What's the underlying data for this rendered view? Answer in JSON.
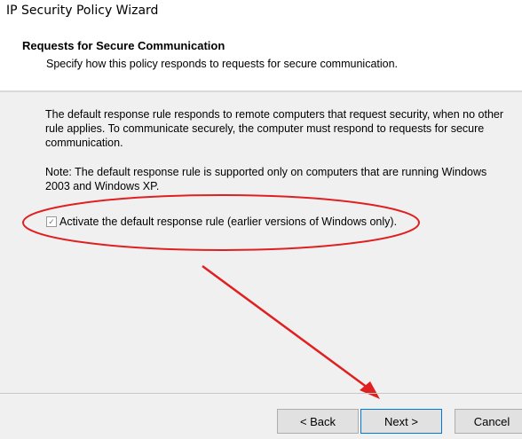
{
  "window": {
    "title": "IP Security Policy Wizard"
  },
  "header": {
    "title": "Requests for Secure Communication",
    "subtitle": "Specify how this policy responds to requests for secure communication."
  },
  "body": {
    "paragraph1": "The default response rule responds to remote computers that request security, when no other rule applies. To communicate securely, the computer must respond to requests for secure communication.",
    "paragraph2": "Note: The default response rule is supported only on computers that are running Windows 2003 and Windows XP.",
    "checkbox": {
      "label": "Activate the default response rule (earlier versions of Windows only).",
      "checked": true,
      "mark": "☑"
    }
  },
  "buttons": {
    "back": "< Back",
    "next": "Next >",
    "cancel": "Cancel"
  },
  "annotation": {
    "color": "#e02020"
  }
}
